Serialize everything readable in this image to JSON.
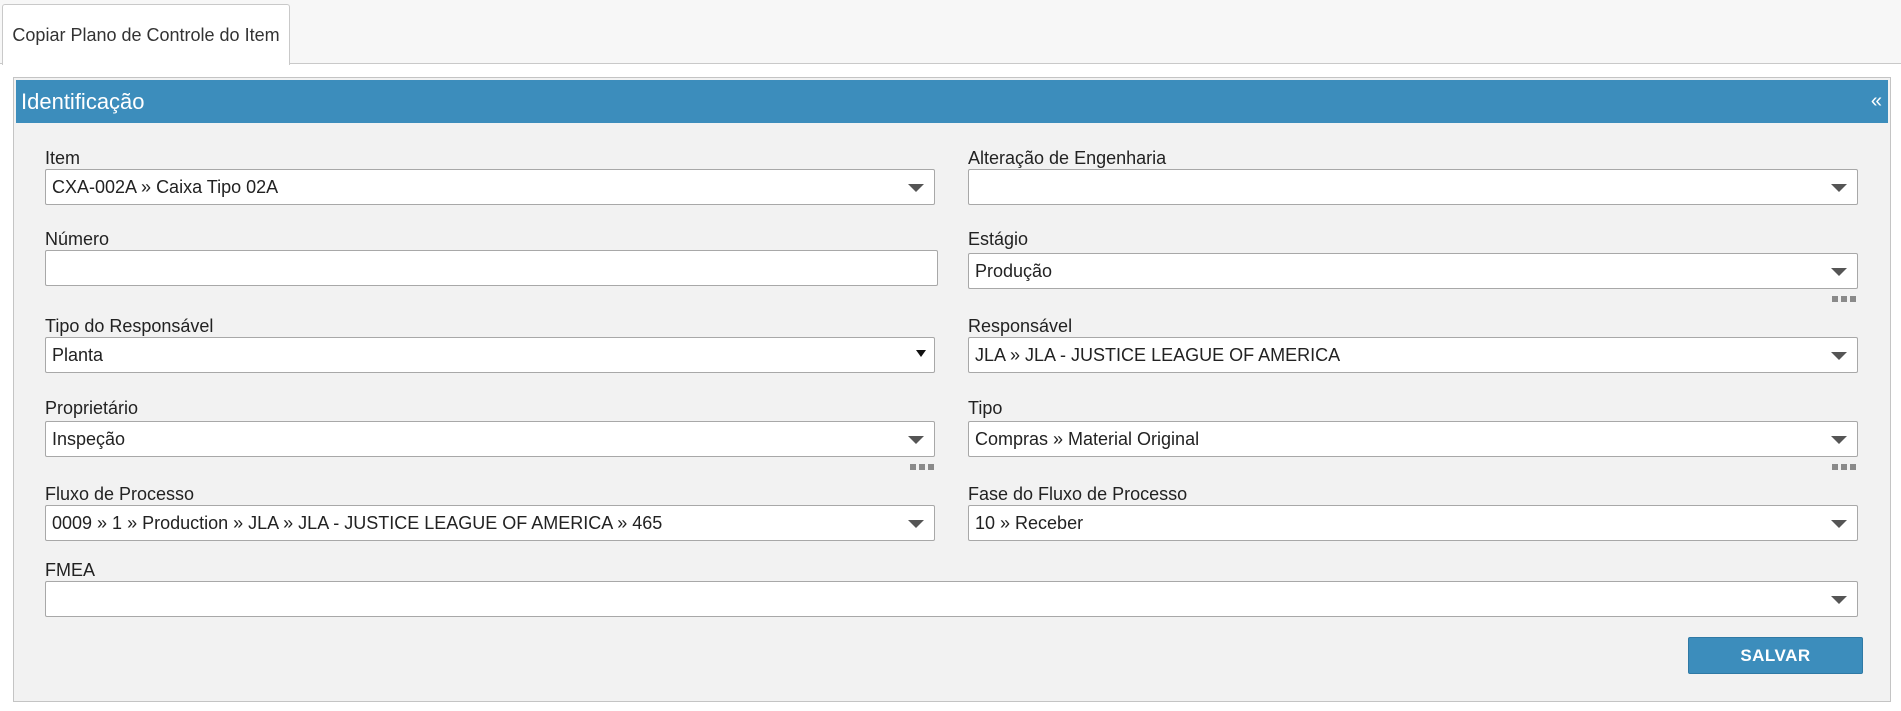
{
  "tabs": [
    {
      "label": "Copiar Plano de Controle do Item"
    }
  ],
  "panel": {
    "title": "Identificação",
    "collapse_glyph": "«"
  },
  "fields": {
    "item": {
      "label": "Item",
      "value": "CXA-002A » Caixa Tipo 02A"
    },
    "alteracao": {
      "label": "Alteração de Engenharia",
      "value": ""
    },
    "numero": {
      "label": "Número",
      "value": ""
    },
    "estagio": {
      "label": "Estágio",
      "value": "Produção"
    },
    "tipo_responsavel": {
      "label": "Tipo do Responsável",
      "value": "Planta"
    },
    "responsavel": {
      "label": "Responsável",
      "value": "JLA » JLA - JUSTICE LEAGUE OF AMERICA"
    },
    "proprietario": {
      "label": "Proprietário",
      "value": "Inspeção"
    },
    "tipo": {
      "label": "Tipo",
      "value": "Compras » Material Original"
    },
    "fluxo": {
      "label": "Fluxo de Processo",
      "value": "0009 » 1 » Production » JLA » JLA - JUSTICE LEAGUE OF AMERICA » 465"
    },
    "fase_fluxo": {
      "label": "Fase do Fluxo de Processo",
      "value": "10 » Receber"
    },
    "fmea": {
      "label": "FMEA",
      "value": ""
    }
  },
  "actions": {
    "save_label": "SALVAR"
  },
  "colors": {
    "accent": "#3c8dbc"
  }
}
